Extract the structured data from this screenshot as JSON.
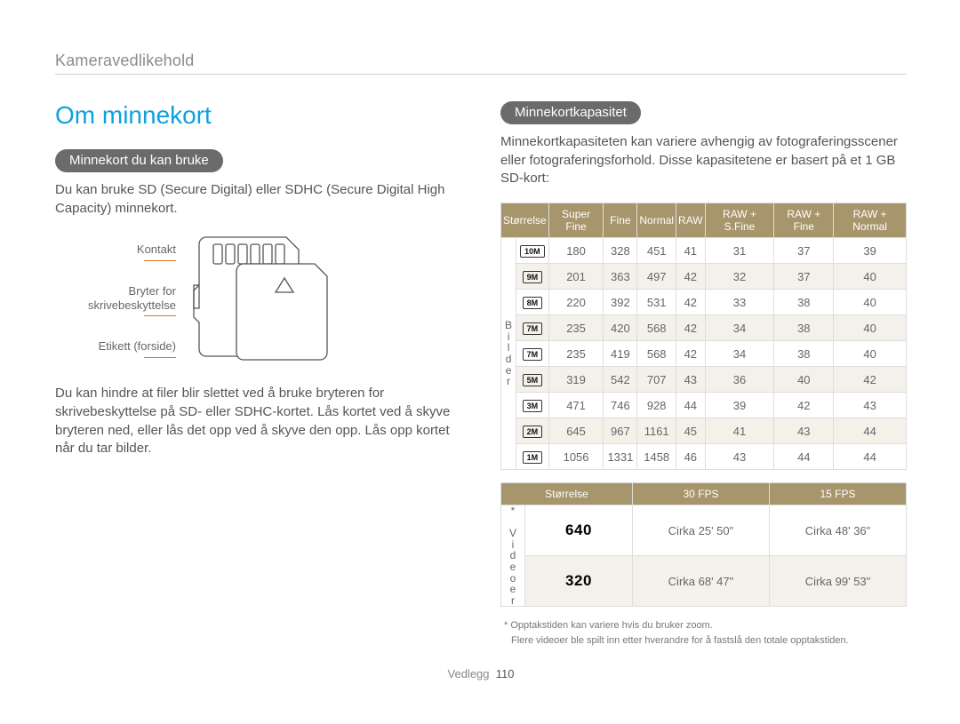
{
  "header": {
    "section": "Kameravedlikehold"
  },
  "left": {
    "title": "Om minnekort",
    "pill": "Minnekort du kan bruke",
    "para1": "Du kan bruke SD (Secure Digital) eller SDHC (Secure Digital High Capacity) minnekort.",
    "sd_labels": {
      "contact": "Kontakt",
      "switch1": "Bryter for",
      "switch2": "skrivebeskyttelse",
      "label": "Etikett (forside)"
    },
    "para2": "Du kan hindre at filer blir slettet ved å bruke bryteren for skrivebeskyttelse på SD- eller SDHC-kortet. Lås kortet ved å skyve bryteren ned, eller lås det opp ved å skyve den opp. Lås opp kortet når du tar bilder."
  },
  "right": {
    "pill": "Minnekortkapasitet",
    "para": "Minnekortkapasiteten kan variere avhengig av fotograferingsscener eller fotograferingsforhold. Disse kapasitetene er basert på et 1 GB SD-kort:",
    "images": {
      "header": [
        "Størrelse",
        "Super Fine",
        "Fine",
        "Normal",
        "RAW",
        "RAW + S.Fine",
        "RAW + Fine",
        "RAW + Normal"
      ],
      "vlabel": "Bilder",
      "rows": [
        {
          "size": "10M",
          "v": [
            "180",
            "328",
            "451",
            "41",
            "31",
            "37",
            "39"
          ]
        },
        {
          "size": "9M",
          "v": [
            "201",
            "363",
            "497",
            "42",
            "32",
            "37",
            "40"
          ]
        },
        {
          "size": "8M",
          "v": [
            "220",
            "392",
            "531",
            "42",
            "33",
            "38",
            "40"
          ]
        },
        {
          "size": "7M",
          "v": [
            "235",
            "420",
            "568",
            "42",
            "34",
            "38",
            "40"
          ]
        },
        {
          "size": "7M",
          "v": [
            "235",
            "419",
            "568",
            "42",
            "34",
            "38",
            "40"
          ]
        },
        {
          "size": "5M",
          "v": [
            "319",
            "542",
            "707",
            "43",
            "36",
            "40",
            "42"
          ]
        },
        {
          "size": "3M",
          "v": [
            "471",
            "746",
            "928",
            "44",
            "39",
            "42",
            "43"
          ]
        },
        {
          "size": "2M",
          "v": [
            "645",
            "967",
            "1161",
            "45",
            "41",
            "43",
            "44"
          ]
        },
        {
          "size": "1M",
          "v": [
            "1056",
            "1331",
            "1458",
            "46",
            "43",
            "44",
            "44"
          ]
        }
      ]
    },
    "videos": {
      "header": [
        "Størrelse",
        "30 FPS",
        "15 FPS"
      ],
      "vlabel": "* Videoer",
      "rows": [
        {
          "size": "640",
          "a": "Cirka 25' 50\"",
          "b": "Cirka 48' 36\""
        },
        {
          "size": "320",
          "a": "Cirka 68' 47\"",
          "b": "Cirka 99' 53\""
        }
      ]
    },
    "note1": "* Opptakstiden kan variere hvis du bruker zoom.",
    "note2": "Flere videoer ble spilt inn etter hverandre for å fastslå den totale opptakstiden."
  },
  "footer": {
    "section": "Vedlegg",
    "page": "110"
  },
  "chart_data": [
    {
      "type": "table",
      "title": "Image capacity on 1 GB SD card",
      "columns": [
        "Størrelse",
        "Super Fine",
        "Fine",
        "Normal",
        "RAW",
        "RAW + S.Fine",
        "RAW + Fine",
        "RAW + Normal"
      ],
      "rows": [
        [
          "10M",
          180,
          328,
          451,
          41,
          31,
          37,
          39
        ],
        [
          "9M",
          201,
          363,
          497,
          42,
          32,
          37,
          40
        ],
        [
          "8M",
          220,
          392,
          531,
          42,
          33,
          38,
          40
        ],
        [
          "7M",
          235,
          420,
          568,
          42,
          34,
          38,
          40
        ],
        [
          "7M",
          235,
          419,
          568,
          42,
          34,
          38,
          40
        ],
        [
          "5M",
          319,
          542,
          707,
          43,
          36,
          40,
          42
        ],
        [
          "3M",
          471,
          746,
          928,
          44,
          39,
          42,
          43
        ],
        [
          "2M",
          645,
          967,
          1161,
          45,
          41,
          43,
          44
        ],
        [
          "1M",
          1056,
          1331,
          1458,
          46,
          43,
          44,
          44
        ]
      ]
    },
    {
      "type": "table",
      "title": "Video capacity on 1 GB SD card",
      "columns": [
        "Størrelse",
        "30 FPS",
        "15 FPS"
      ],
      "rows": [
        [
          "640",
          "Cirka 25' 50\"",
          "Cirka 48' 36\""
        ],
        [
          "320",
          "Cirka 68' 47\"",
          "Cirka 99' 53\""
        ]
      ]
    }
  ]
}
